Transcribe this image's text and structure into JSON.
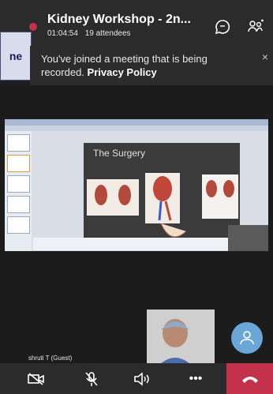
{
  "header": {
    "title": "Kidney Workshop - 2n...",
    "duration": "01:04:54",
    "attendees": "19 attendees"
  },
  "side_tag": {
    "label": "ne"
  },
  "banner": {
    "message": "You've joined a meeting that is being recorded.",
    "link_label": "Privacy Policy",
    "close_label": "×"
  },
  "presentation": {
    "slide_title": "The Surgery"
  },
  "participant": {
    "name": "shruti T (Guest)"
  },
  "controls": {
    "more_label": "•••"
  },
  "colors": {
    "record_dot": "#c4314b",
    "leave_button": "#c4314b",
    "fab": "#6aa6d6"
  }
}
